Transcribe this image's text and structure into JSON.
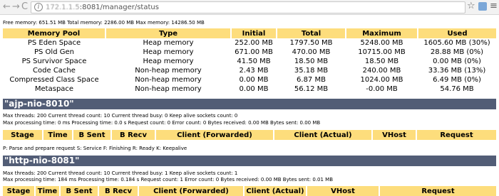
{
  "browser": {
    "url_host": "172.1.1.5",
    "url_path": ":8081/manager/status",
    "nav_back": "←",
    "nav_forward": "→",
    "nav_reload": "C",
    "star_glyph": "☆",
    "menu_glyph": "≡"
  },
  "memory_summary": "Free memory: 651.51 MB Total memory: 2286.00 MB Max memory: 14286.50 MB",
  "memory_table": {
    "headers": [
      "Memory Pool",
      "Type",
      "Initial",
      "Total",
      "Maximum",
      "Used"
    ],
    "rows": [
      [
        "PS Eden Space",
        "Heap memory",
        "252.00 MB",
        "1797.50 MB",
        "5248.00 MB",
        "1605.60 MB (30%)"
      ],
      [
        "PS Old Gen",
        "Heap memory",
        "671.00 MB",
        "470.00 MB",
        "10715.00 MB",
        "28.88 MB (0%)"
      ],
      [
        "PS Survivor Space",
        "Heap memory",
        "41.50 MB",
        "18.50 MB",
        "18.50 MB",
        "0.00 MB (0%)"
      ],
      [
        "Code Cache",
        "Non-heap memory",
        "2.43 MB",
        "35.18 MB",
        "240.00 MB",
        "33.36 MB (13%)"
      ],
      [
        "Compressed Class Space",
        "Non-heap memory",
        "0.00 MB",
        "6.87 MB",
        "1024.00 MB",
        "6.49 MB (0%)"
      ],
      [
        "Metaspace",
        "Non-heap memory",
        "0.00 MB",
        "56.12 MB",
        "-0.00 MB",
        "54.76 MB"
      ]
    ]
  },
  "connectors": [
    {
      "name": "\"ajp-nio-8010\"",
      "threads_line": "Max threads: 200 Current thread count: 10 Current thread busy: 0 Keep alive sockets count: 0",
      "processing_line": "Max processing time: 0 ms Processing time: 0.0 s Request count: 0 Error count: 0 Bytes received: 0.00 MB Bytes sent: 0.00 MB",
      "headers": [
        "Stage",
        "Time",
        "B Sent",
        "B Recv",
        "Client (Forwarded)",
        "Client (Actual)",
        "VHost",
        "Request"
      ],
      "legend": "P: Parse and prepare request S: Service F: Finishing R: Ready K: Keepalive"
    },
    {
      "name": "\"http-nio-8081\"",
      "threads_line": "Max threads: 200 Current thread count: 10 Current thread busy: 1 Keep alive sockets count: 1",
      "processing_line": "Max processing time: 184 ms Processing time: 0.184 s Request count: 1 Error count: 0 Bytes received: 0.00 MB Bytes sent: 0.01 MB",
      "headers": [
        "Stage",
        "Time",
        "B Sent",
        "B Recv",
        "Client (Forwarded)",
        "Client (Actual)",
        "VHost",
        "Request"
      ]
    }
  ]
}
